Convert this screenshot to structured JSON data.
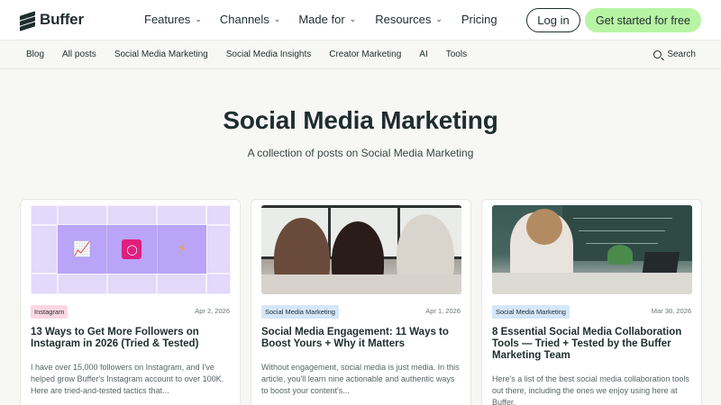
{
  "brand": {
    "name": "Buffer"
  },
  "nav": {
    "items": [
      {
        "label": "Features"
      },
      {
        "label": "Channels"
      },
      {
        "label": "Made for"
      },
      {
        "label": "Resources"
      },
      {
        "label": "Pricing"
      }
    ],
    "login": "Log in",
    "cta": "Get started for free"
  },
  "subnav": {
    "items": [
      "Blog",
      "All posts",
      "Social Media Marketing",
      "Social Media Insights",
      "Creator Marketing",
      "AI",
      "Tools"
    ],
    "search": "Search"
  },
  "hero": {
    "title": "Social Media Marketing",
    "subtitle": "A collection of posts on Social Media Marketing"
  },
  "cards": [
    {
      "tag": "Instagram",
      "date": "Apr 2, 2026",
      "title": "13 Ways to Get More Followers on Instagram in 2026 (Tried & Tested)",
      "excerpt": "I have over 15,000 followers on Instagram, and I've helped grow Buffer's Instagram account to over 100K. Here are tried-and-tested tactics that..."
    },
    {
      "tag": "Social Media Marketing",
      "date": "Apr 1, 2026",
      "title": "Social Media Engagement: 11 Ways to Boost Yours + Why it Matters",
      "excerpt": "Without engagement, social media is just media. In this article, you'll learn nine actionable and authentic ways to boost your content's..."
    },
    {
      "tag": "Social Media Marketing",
      "date": "Mar 30, 2026",
      "title": "8 Essential Social Media Collaboration Tools — Tried + Tested by the Buffer Marketing Team",
      "excerpt": "Here's a list of the best social media collaboration tools out there, including the ones we enjoy using here at Buffer."
    }
  ],
  "colors": {
    "cta_bg": "#b7f4a4",
    "tag_pink": "#fbd7e3",
    "tag_blue": "#d5e7fa",
    "text": "#1f2d2d"
  },
  "icons": [
    "buffer-logo-icon",
    "chevron-down-icon",
    "search-icon",
    "chart-icon",
    "instagram-icon",
    "bolt-icon"
  ]
}
